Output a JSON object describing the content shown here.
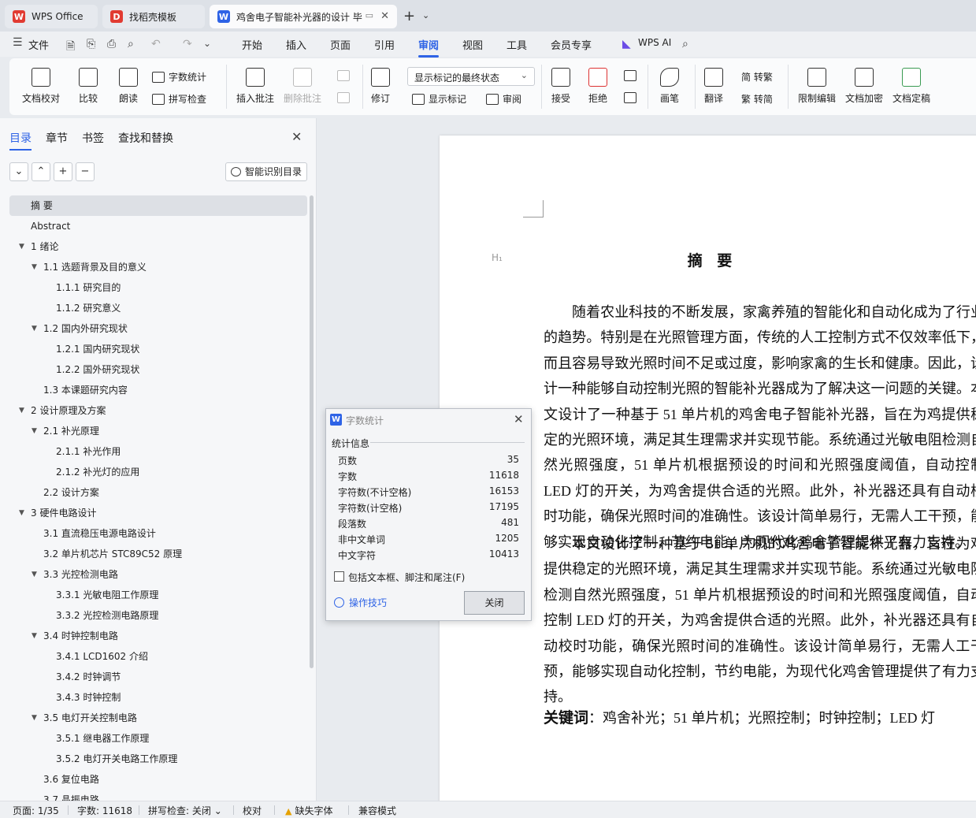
{
  "tabs": [
    {
      "label": "WPS Office",
      "logo": "W",
      "color": "#e13b32"
    },
    {
      "label": "找稻壳模板",
      "logo": "D",
      "color": "#e13b32"
    },
    {
      "label": "鸡舍电子智能补光器的设计 毕",
      "logo": "W",
      "color": "#2e63e6"
    }
  ],
  "menu": {
    "file": "文件",
    "items": [
      "开始",
      "插入",
      "页面",
      "引用",
      "审阅",
      "视图",
      "工具",
      "会员专享"
    ],
    "active": "审阅",
    "ai": "WPS AI"
  },
  "ribbon": {
    "doc_proof": "文档校对",
    "compare": "比较",
    "read_aloud": "朗读",
    "word_count": "字数统计",
    "spell_check": "拼写检查",
    "insert_comment": "插入批注",
    "delete_comment": "删除批注",
    "revise": "修订",
    "markup_select": "显示标记的最终状态",
    "show_markup": "显示标记",
    "review": "审阅",
    "accept": "接受",
    "reject": "拒绝",
    "pen": "画笔",
    "translate": "翻译",
    "to_traditional": "简 转繁",
    "to_simplified": "繁 转简",
    "restrict_edit": "限制编辑",
    "encrypt": "文档加密",
    "finalize": "文档定稿"
  },
  "navpanel": {
    "tabs": [
      "目录",
      "章节",
      "书签",
      "查找和替换"
    ],
    "smart_button": "智能识别目录",
    "toc": [
      {
        "label": "摘 要",
        "level": 0,
        "tri": false,
        "selected": true
      },
      {
        "label": "Abstract",
        "level": 0,
        "tri": false
      },
      {
        "label": "1  绪论",
        "level": 0,
        "tri": true
      },
      {
        "label": "1.1   选题背景及目的意义",
        "level": 1,
        "tri": true
      },
      {
        "label": "1.1.1  研究目的",
        "level": 2,
        "tri": false
      },
      {
        "label": "1.1.2  研究意义",
        "level": 2,
        "tri": false
      },
      {
        "label": "1.2    国内外研究现状",
        "level": 1,
        "tri": true
      },
      {
        "label": "1.2.1    国内研究现状",
        "level": 2,
        "tri": false
      },
      {
        "label": "1.2.2    国外研究现状",
        "level": 2,
        "tri": false
      },
      {
        "label": "1.3    本课题研究内容",
        "level": 1,
        "tri": false
      },
      {
        "label": "2    设计原理及方案",
        "level": 0,
        "tri": true
      },
      {
        "label": "2.1    补光原理",
        "level": 1,
        "tri": true
      },
      {
        "label": "2.1.1  补光作用",
        "level": 2,
        "tri": false
      },
      {
        "label": "2.1.2  补光灯的应用",
        "level": 2,
        "tri": false
      },
      {
        "label": "2.2    设计方案",
        "level": 1,
        "tri": false
      },
      {
        "label": "3    硬件电路设计",
        "level": 0,
        "tri": true
      },
      {
        "label": "3.1    直流稳压电源电路设计",
        "level": 1,
        "tri": false
      },
      {
        "label": "3.2    单片机芯片 STC89C52 原理",
        "level": 1,
        "tri": false
      },
      {
        "label": "3.3    光控检测电路",
        "level": 1,
        "tri": true
      },
      {
        "label": "3.3.1  光敏电阻工作原理",
        "level": 2,
        "tri": false
      },
      {
        "label": "3.3.2    光控检测电路原理",
        "level": 2,
        "tri": false
      },
      {
        "label": "3.4    时钟控制电路",
        "level": 1,
        "tri": true
      },
      {
        "label": "3.4.1 LCD1602 介绍",
        "level": 2,
        "tri": false
      },
      {
        "label": "3.4.2  时钟调节",
        "level": 2,
        "tri": false
      },
      {
        "label": "3.4.3  时钟控制",
        "level": 2,
        "tri": false
      },
      {
        "label": "3.5    电灯开关控制电路",
        "level": 1,
        "tri": true
      },
      {
        "label": "3.5.1  继电器工作原理",
        "level": 2,
        "tri": false
      },
      {
        "label": "3.5.2  电灯开关电路工作原理",
        "level": 2,
        "tri": false
      },
      {
        "label": "3.6    复位电路",
        "level": 1,
        "tri": false
      },
      {
        "label": "3.7    晶振电路",
        "level": 1,
        "tri": false
      }
    ]
  },
  "document": {
    "heading_mark": "H₁",
    "title": "摘 要",
    "para1": "随着农业科技的不断发展，家禽养殖的智能化和自动化成为了行业的趋势。特别是在光照管理方面，传统的人工控制方式不仅效率低下，而且容易导致光照时间不足或过度，影响家禽的生长和健康。因此，设计一种能够自动控制光照的智能补光器成为了解决这一问题的关键。本文设计了一种基于 51 单片机的鸡舍电子智能补光器，旨在为鸡提供稳定的光照环境，满足其生理需求并实现节能。系统通过光敏电阻检测自然光照强度，51 单片机根据预设的时间和光照强度阈值，自动控制 LED 灯的开关，为鸡舍提供合适的光照。此外，补光器还具有自动校时功能，确保光照时间的准确性。该设计简单易行，无需人工干预，能够实现自动化控制，节约电能，为现代化鸡舍管理提供了有力支持。",
    "para2": "本文设计了一种基于 51 单片机的鸡舍电子智能补光器，旨在为鸡提供稳定的光照环境，满足其生理需求并实现节能。系统通过光敏电阻检测自然光照强度，51 单片机根据预设的时间和光照强度阈值，自动控制 LED 灯的开关，为鸡舍提供合适的光照。此外，补光器还具有自动校时功能，确保光照时间的准确性。该设计简单易行，无需人工干预，能够实现自动化控制，节约电能，为现代化鸡舍管理提供了有力支持。",
    "keywords_label": "关键词",
    "keywords": "：鸡舍补光；51 单片机；光照控制；时钟控制；LED 灯"
  },
  "dialog": {
    "title": "字数统计",
    "section": "统计信息",
    "stats": [
      {
        "label": "页数",
        "value": "35"
      },
      {
        "label": "字数",
        "value": "11618"
      },
      {
        "label": "字符数(不计空格)",
        "value": "16153"
      },
      {
        "label": "字符数(计空格)",
        "value": "17195"
      },
      {
        "label": "段落数",
        "value": "481"
      },
      {
        "label": "非中文单词",
        "value": "1205"
      },
      {
        "label": "中文字符",
        "value": "10413"
      }
    ],
    "checkbox_label": "包括文本框、脚注和尾注(F)",
    "tips_link": "操作技巧",
    "close_button": "关闭"
  },
  "statusbar": {
    "page": "页面: 1/35",
    "words": "字数: 11618",
    "spell": "拼写检查: 关闭",
    "proof": "校对",
    "missing_font": "缺失字体",
    "compat": "兼容模式"
  }
}
